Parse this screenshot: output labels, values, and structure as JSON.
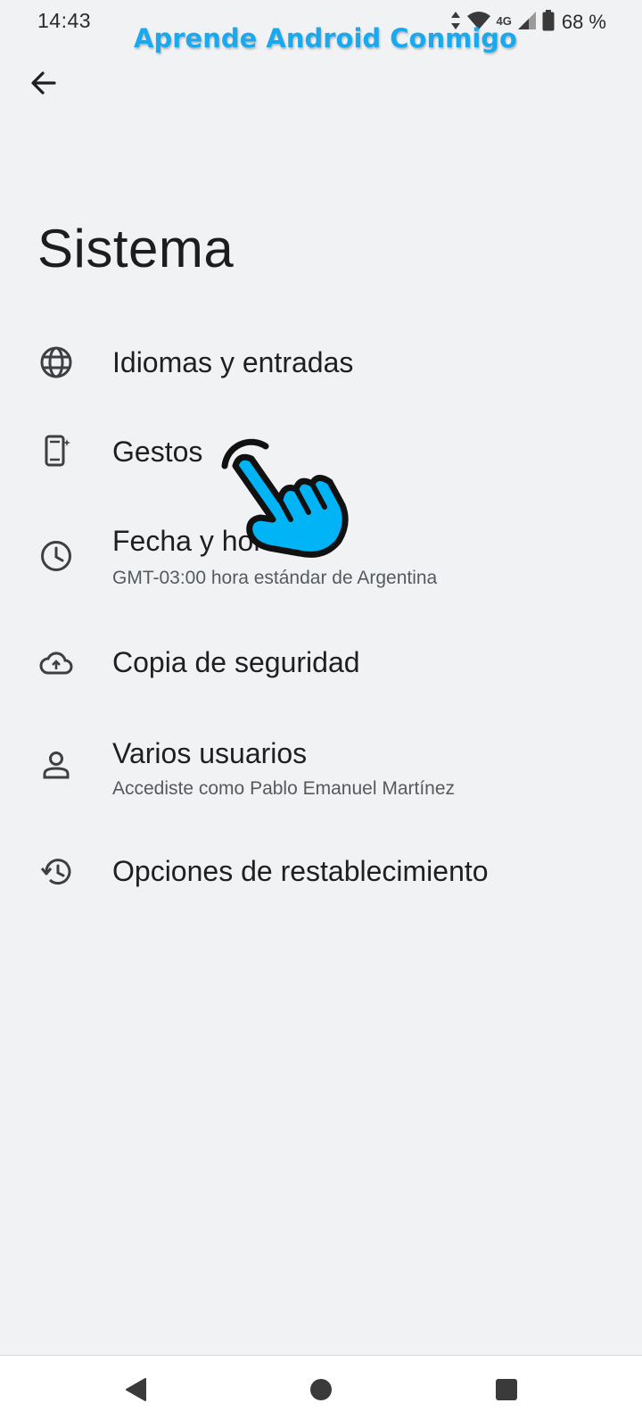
{
  "status_bar": {
    "time": "14:43",
    "network_label": "4G",
    "battery_text": "68 %",
    "icons": [
      "data-arrows-icon",
      "wifi-icon",
      "signal-icon",
      "battery-icon"
    ]
  },
  "watermark": {
    "text": "Aprende Android Conmigo",
    "color": "#19a9ef"
  },
  "header": {
    "back_icon": "arrow-back-icon",
    "title": "Sistema"
  },
  "settings": {
    "items": [
      {
        "icon": "globe-icon",
        "title": "Idiomas y entradas",
        "subtitle": ""
      },
      {
        "icon": "phone-gesture-icon",
        "title": "Gestos",
        "subtitle": ""
      },
      {
        "icon": "clock-icon",
        "title": "Fecha y hora",
        "subtitle": "GMT-03:00 hora estándar de Argentina"
      },
      {
        "icon": "cloud-upload-icon",
        "title": "Copia de seguridad",
        "subtitle": ""
      },
      {
        "icon": "person-icon",
        "title": "Varios usuarios",
        "subtitle": "Accediste como Pablo Emanuel Martínez"
      },
      {
        "icon": "history-icon",
        "title": "Opciones de restablecimiento",
        "subtitle": ""
      }
    ]
  },
  "overlay": {
    "pointer_icon": "pointing-hand-icon",
    "pointer_color": "#00b4f5"
  },
  "nav_bar": {
    "back_icon": "nav-back-triangle-icon",
    "home_icon": "nav-home-circle-icon",
    "recents_icon": "nav-recents-square-icon"
  },
  "colors": {
    "background": "#f1f2f4",
    "text_primary": "#1f1f1f",
    "text_secondary": "#555a5f"
  }
}
